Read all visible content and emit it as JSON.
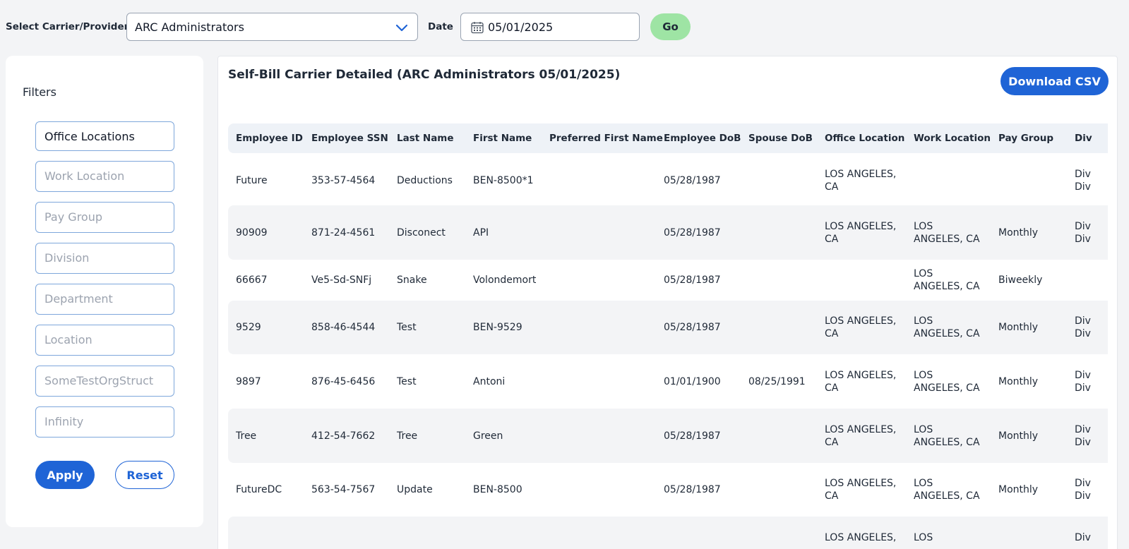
{
  "topbar": {
    "carrier_label": "Select Carrier/Provider",
    "carrier_value": "ARC Administrators",
    "date_label": "Date",
    "date_value": "05/01/2025",
    "go_label": "Go"
  },
  "filters": {
    "title": "Filters",
    "fields": [
      {
        "label": "Office Locations",
        "filled": true
      },
      {
        "label": "Work Location",
        "filled": false
      },
      {
        "label": "Pay Group",
        "filled": false
      },
      {
        "label": "Division",
        "filled": false
      },
      {
        "label": "Department",
        "filled": false
      },
      {
        "label": "Location",
        "filled": false
      },
      {
        "label": "SomeTestOrgStruct",
        "filled": false
      },
      {
        "label": "Infinity",
        "filled": false
      }
    ],
    "apply_label": "Apply",
    "reset_label": "Reset"
  },
  "report": {
    "title": "Self-Bill Carrier Detailed (ARC Administrators 05/01/2025)",
    "download_label": "Download CSV",
    "columns": [
      "Employee ID",
      "Employee SSN",
      "Last Name",
      "First Name",
      "Preferred First Name",
      "Employee DoB",
      "Spouse DoB",
      "Office Location",
      "Work Location",
      "Pay Group",
      "Div"
    ],
    "rows": [
      {
        "id": "Future",
        "ssn": "353-57-4564",
        "last": "Deductions",
        "first": "BEN-8500*1",
        "pref": "",
        "dob": "05/28/1987",
        "sdob": "",
        "office": [
          "LOS ANGELES,",
          "CA"
        ],
        "work": [],
        "pay": "",
        "div": [
          "Div",
          "Div"
        ]
      },
      {
        "id": "90909",
        "ssn": "871-24-4561",
        "last": "Disconect",
        "first": "API",
        "pref": "",
        "dob": "05/28/1987",
        "sdob": "",
        "office": [
          "LOS ANGELES,",
          "CA"
        ],
        "work": [
          "LOS",
          "ANGELES, CA"
        ],
        "pay": "Monthly",
        "div": [
          "Div",
          "Div"
        ]
      },
      {
        "id": "66667",
        "ssn": "Ve5-Sd-SNFj",
        "last": "Snake",
        "first": "Volondemort",
        "pref": "",
        "dob": "05/28/1987",
        "sdob": "",
        "office": [],
        "work": [
          "LOS",
          "ANGELES, CA"
        ],
        "pay": "Biweekly",
        "div": []
      },
      {
        "id": "9529",
        "ssn": "858-46-4544",
        "last": "Test",
        "first": "BEN-9529",
        "pref": "",
        "dob": "05/28/1987",
        "sdob": "",
        "office": [
          "LOS ANGELES,",
          "CA"
        ],
        "work": [
          "LOS",
          "ANGELES, CA"
        ],
        "pay": "Monthly",
        "div": [
          "Div",
          "Div"
        ]
      },
      {
        "id": "9897",
        "ssn": "876-45-6456",
        "last": "Test",
        "first": "Antoni",
        "pref": "",
        "dob": "01/01/1900",
        "sdob": "08/25/1991",
        "office": [
          "LOS ANGELES,",
          "CA"
        ],
        "work": [
          "LOS",
          "ANGELES, CA"
        ],
        "pay": "Monthly",
        "div": [
          "Div",
          "Div"
        ]
      },
      {
        "id": "Tree",
        "ssn": "412-54-7662",
        "last": "Tree",
        "first": "Green",
        "pref": "",
        "dob": "05/28/1987",
        "sdob": "",
        "office": [
          "LOS ANGELES,",
          "CA"
        ],
        "work": [
          "LOS",
          "ANGELES, CA"
        ],
        "pay": "Monthly",
        "div": [
          "Div",
          "Div"
        ]
      },
      {
        "id": "FutureDC",
        "ssn": "563-54-7567",
        "last": "Update",
        "first": "BEN-8500",
        "pref": "",
        "dob": "05/28/1987",
        "sdob": "",
        "office": [
          "LOS ANGELES,",
          "CA"
        ],
        "work": [
          "LOS",
          "ANGELES, CA"
        ],
        "pay": "Monthly",
        "div": [
          "Div",
          "Div"
        ]
      },
      {
        "id": "",
        "ssn": "",
        "last": "",
        "first": "",
        "pref": "",
        "dob": "",
        "sdob": "",
        "office": [
          "LOS ANGELES,",
          ""
        ],
        "work": [
          "LOS",
          ""
        ],
        "pay": "",
        "div": [
          "Div",
          ""
        ]
      }
    ]
  },
  "colors": {
    "accent": "#1f64d6",
    "go": "#9ee4a4",
    "input_border": "#7ea7db"
  }
}
